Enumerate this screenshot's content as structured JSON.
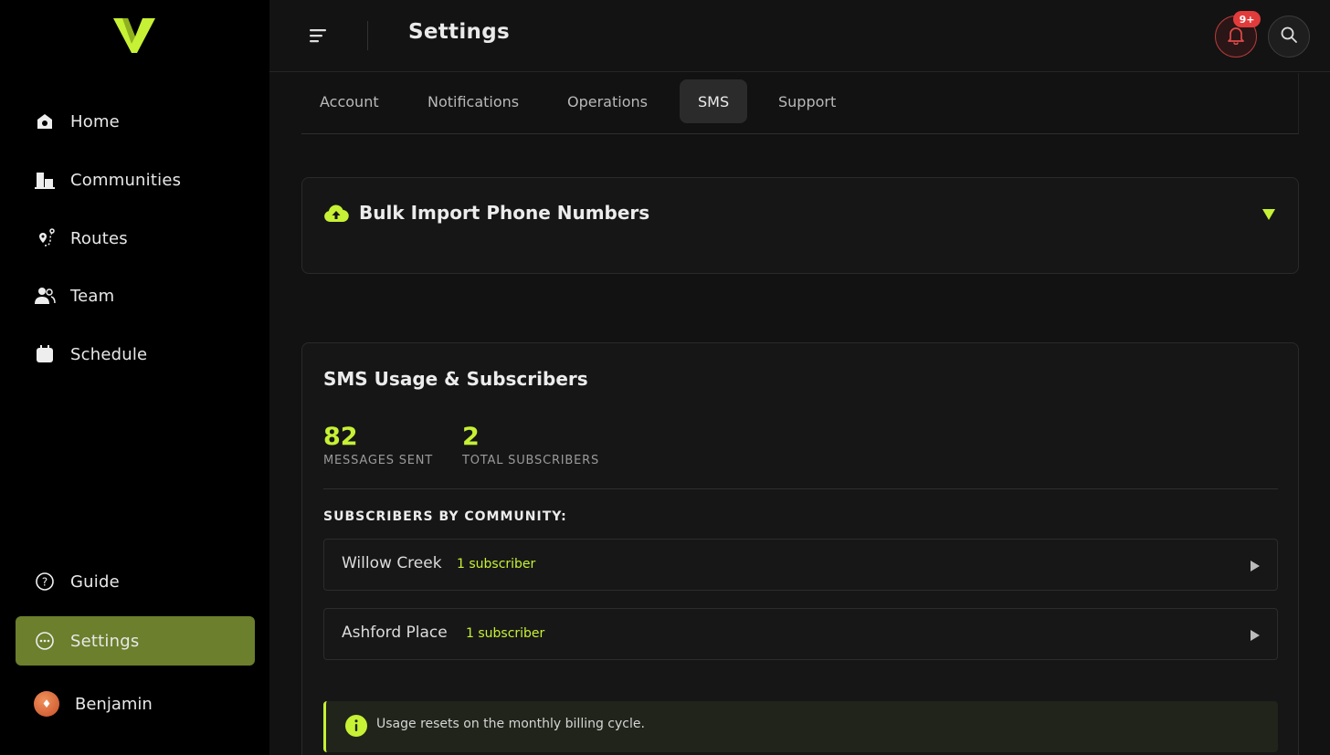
{
  "colors": {
    "accent": "#c6f135",
    "active_nav": "#6b7f2c",
    "sidebar_bg": "#000000",
    "page_bg": "#121212",
    "badge": "#e23b3b"
  },
  "sidebar": {
    "items": [
      {
        "label": "Home",
        "icon": "home-icon"
      },
      {
        "label": "Communities",
        "icon": "buildings-icon"
      },
      {
        "label": "Routes",
        "icon": "route-icon"
      },
      {
        "label": "Team",
        "icon": "team-icon"
      },
      {
        "label": "Schedule",
        "icon": "calendar-icon"
      }
    ],
    "bottom_items": [
      {
        "label": "Guide",
        "icon": "help-circle-icon"
      },
      {
        "label": "Settings",
        "icon": "settings-dots-icon",
        "active": true
      }
    ],
    "user": {
      "name": "Benjamin"
    }
  },
  "header": {
    "title": "Settings",
    "notifications_badge": "9+"
  },
  "tabs": [
    {
      "label": "Account"
    },
    {
      "label": "Notifications"
    },
    {
      "label": "Operations"
    },
    {
      "label": "SMS",
      "active": true
    },
    {
      "label": "Support"
    }
  ],
  "import_panel": {
    "title": "Bulk Import Phone Numbers"
  },
  "usage": {
    "title": "SMS Usage & Subscribers",
    "stats": [
      {
        "value": "82",
        "caption": "MESSAGES SENT"
      },
      {
        "value": "2",
        "caption": "TOTAL SUBSCRIBERS"
      }
    ],
    "section_label": "SUBSCRIBERS BY COMMUNITY:",
    "communities": [
      {
        "name": "Willow Creek",
        "count": "1 subscriber"
      },
      {
        "name": "Ashford Place",
        "count": "1 subscriber"
      }
    ],
    "info": "Usage resets on the monthly billing cycle."
  }
}
